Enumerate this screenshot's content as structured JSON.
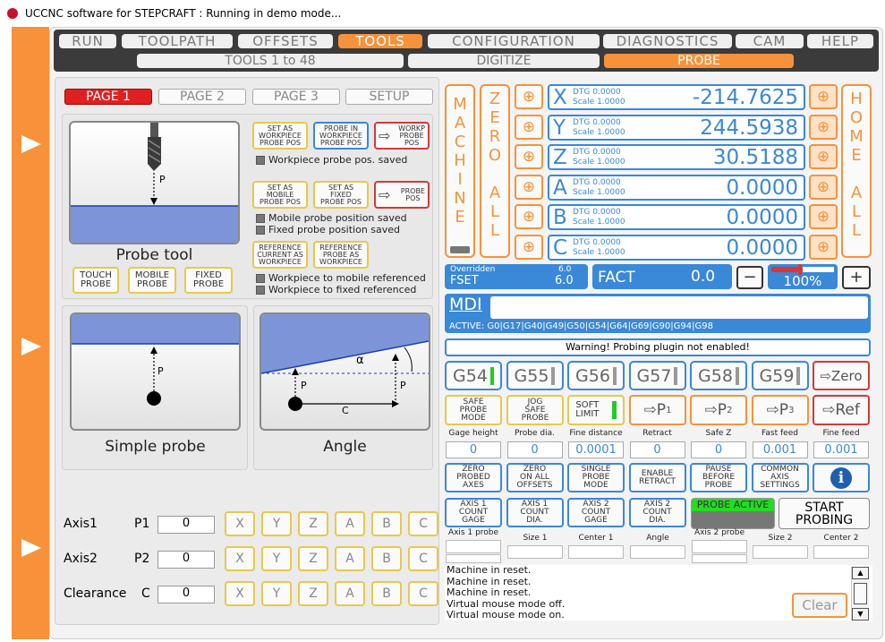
{
  "window": {
    "title": "UCCNC software for STEPCRAFT : Running in demo mode..."
  },
  "colors": {
    "accent": "#f7923a",
    "blue": "#3a88d8",
    "red": "#d63838",
    "yellow": "#e8c84a",
    "green": "#22cc22"
  },
  "main_tabs": [
    "RUN",
    "TOOLPATH",
    "OFFSETS",
    "TOOLS",
    "CONFIGURATION",
    "DIAGNOSTICS",
    "CAM",
    "HELP"
  ],
  "active_tab": "TOOLS",
  "sub_tabs": [
    "TOOLS  1 to 48",
    "DIGITIZE",
    "PROBE"
  ],
  "pages": [
    "PAGE 1",
    "PAGE 2",
    "PAGE 3",
    "SETUP"
  ],
  "probe_tool": {
    "label": "Probe tool",
    "p": "P",
    "buttons": [
      "TOUCH\nPROBE",
      "MOBILE\nPROBE",
      "FIXED\nPROBE"
    ]
  },
  "probe_settings": {
    "set_wp": "SET AS\nWORKPIECE\nPROBE POS",
    "probe_in_wp": "PROBE IN\nWORKPIECE\nPROBE POS",
    "workp_probe": "WORKP\nPROBE\nPOS",
    "wp_saved": "Workpiece probe pos. saved",
    "set_mobile": "SET AS\nMOBILE\nPROBE POS",
    "set_fixed": "SET AS\nFIXED\nPROBE POS",
    "probe_pos": "PROBE\nPOS",
    "mobile_saved": "Mobile probe position saved",
    "fixed_saved": "Fixed probe position saved",
    "ref_current": "REFERENCE\nCURRENT AS\nWORKPIECE",
    "ref_probe": "REFERENCE\nPROBE AS\nWORKPIECE",
    "wp_mobile": "Workpiece to mobile referenced",
    "wp_fixed": "Workpiece to fixed referenced"
  },
  "simple_probe": {
    "label": "Simple probe",
    "p": "P"
  },
  "angle": {
    "label": "Angle",
    "p1": "P",
    "p2": "P",
    "c": "C",
    "alpha": "α"
  },
  "axis_rows": [
    {
      "label": "Axis1",
      "sub": "P1",
      "value": "0"
    },
    {
      "label": "Axis2",
      "sub": "P2",
      "value": "0"
    },
    {
      "label": "Clearance",
      "sub": "C",
      "value": "0"
    }
  ],
  "axis_letters": [
    "X",
    "Y",
    "Z",
    "A",
    "B",
    "C"
  ],
  "machine": "MACHINE",
  "zero_all": "ZERO ALL",
  "home_all": "HOME ALL",
  "dro": [
    {
      "axis": "X",
      "dtg": "DTG  0.0000",
      "scale": "Scale 1.0000",
      "value": "-214.7625"
    },
    {
      "axis": "Y",
      "dtg": "DTG  0.0000",
      "scale": "Scale 1.0000",
      "value": "244.5938"
    },
    {
      "axis": "Z",
      "dtg": "DTG  0.0000",
      "scale": "Scale 1.0000",
      "value": "30.5188"
    },
    {
      "axis": "A",
      "dtg": "DTG  0.0000",
      "scale": "Scale 1.0000",
      "value": "0.0000"
    },
    {
      "axis": "B",
      "dtg": "DTG  0.0000",
      "scale": "Scale 1.0000",
      "value": "0.0000"
    },
    {
      "axis": "C",
      "dtg": "DTG  0.0000",
      "scale": "Scale 1.0000",
      "value": "0.0000"
    }
  ],
  "feed": {
    "overridden": "Overridden",
    "overridden_val": "6.0",
    "fset": "FSET",
    "fset_val": "6.0",
    "fact": "FACT",
    "fact_val": "0.0",
    "minus": "−",
    "plus": "+",
    "percent": "100%",
    "override_level": 1.0
  },
  "mdi": {
    "label": "MDI",
    "active": "ACTIVE: G0|G17|G40|G49|G50|G54|G64|G69|G90|G94|G98"
  },
  "warning": "Warning! Probing plugin not enabled!",
  "g_buttons": [
    "G54",
    "G55",
    "G56",
    "G57",
    "G58",
    "G59"
  ],
  "zero_btn": "⇨Zero",
  "mode_buttons": {
    "safe": "SAFE\nPROBE\nMODE",
    "jog": "JOG\nSAFE\nPROBE",
    "soft": "SOFT\nLIMIT",
    "p1": "⇨P",
    "p2": "⇨P",
    "p3": "⇨P",
    "ref": "⇨Ref",
    "p1s": "1",
    "p2s": "2",
    "p3s": "3"
  },
  "params": [
    {
      "label": "Gage height",
      "value": "0"
    },
    {
      "label": "Probe dia.",
      "value": "0"
    },
    {
      "label": "Fine distance",
      "value": "0.0001"
    },
    {
      "label": "Retract",
      "value": "0"
    },
    {
      "label": "Safe Z",
      "value": "0"
    },
    {
      "label": "Fast feed",
      "value": "0.001"
    },
    {
      "label": "Fine feed",
      "value": "0.001"
    }
  ],
  "func_buttons": [
    "ZERO\nPROBED\nAXES",
    "ZERO\nON ALL\nOFFSETS",
    "SINGLE\nPROBE\nMODE",
    "ENABLE\nRETRACT",
    "PAUSE\nBEFORE\nPROBE",
    "COMMON\nAXIS\nSETTINGS"
  ],
  "info": "i",
  "axis_buttons": [
    "AXIS 1\nCOUNT\nGAGE",
    "AXIS 1\nCOUNT\nDIA.",
    "AXIS 2\nCOUNT\nGAGE",
    "AXIS 2\nCOUNT\nDIA."
  ],
  "probe_active": "PROBE ACTIVE",
  "start_probing": "START\nPROBING",
  "result_labels": [
    "Axis 1 probe",
    "Size 1",
    "Center 1",
    "Angle",
    "Axis 2 probe",
    "Size 2",
    "Center 2"
  ],
  "log": [
    "Machine in reset.",
    "Machine in reset.",
    "Machine in reset.",
    "Virtual mouse mode off.",
    "Virtual mouse mode on."
  ],
  "clear": "Clear"
}
